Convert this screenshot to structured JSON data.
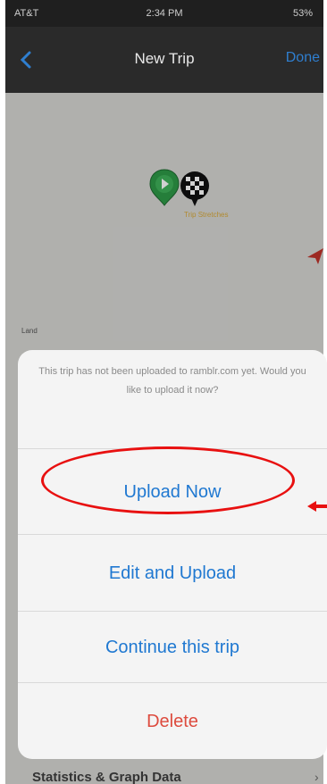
{
  "status_bar": {
    "carrier": "AT&T",
    "time": "2:34 PM",
    "battery": "53%"
  },
  "nav": {
    "back_icon": "chevron-left-icon",
    "title": "New Trip",
    "done_label": "Done"
  },
  "map": {
    "marker_label": "Trip Stretches",
    "corner_label": "Land"
  },
  "action_sheet": {
    "message": "This trip has not been uploaded to ramblr.com yet. Would you like to upload it now?",
    "actions": [
      {
        "label": "Upload Now",
        "style": "default"
      },
      {
        "label": "Edit and Upload",
        "style": "default"
      },
      {
        "label": "Continue this trip",
        "style": "default"
      },
      {
        "label": "Delete",
        "style": "destructive"
      }
    ]
  },
  "bottom_peek": {
    "label": "Statistics & Graph Data"
  },
  "colors": {
    "accent_blue": "#1f78d1",
    "destructive_red": "#dd4b3e",
    "annotation_red": "#e81010"
  }
}
